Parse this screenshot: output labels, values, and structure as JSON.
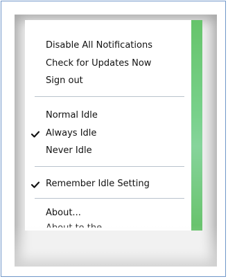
{
  "menu": {
    "items": [
      {
        "label": "Disable All Notifications",
        "checked": false
      },
      {
        "label": "Check for Updates Now",
        "checked": false
      },
      {
        "label": "Sign out",
        "checked": false
      },
      {
        "label": "Normal Idle",
        "checked": false
      },
      {
        "label": "Always Idle",
        "checked": true
      },
      {
        "label": "Never Idle",
        "checked": false
      },
      {
        "label": "Remember Idle Setting",
        "checked": true
      },
      {
        "label": "About...",
        "checked": false
      }
    ],
    "partial_item_label": "About to the...",
    "check_icon": "checkmark-icon"
  },
  "colors": {
    "accent_green": "#66c46b",
    "frame_border": "#6f96c9"
  }
}
